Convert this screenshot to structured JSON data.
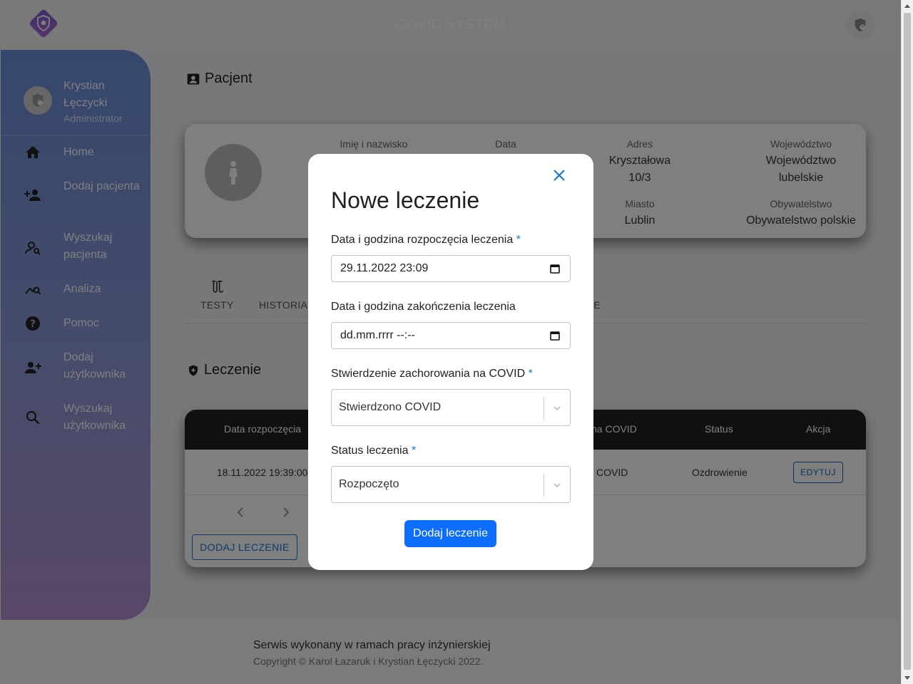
{
  "header": {
    "title": "COVID SYSTEM"
  },
  "user": {
    "name": "Krystian Łęczycki",
    "role": "Administrator"
  },
  "sidebar": {
    "items": [
      {
        "label": "Home",
        "icon": "home-icon"
      },
      {
        "label": "Dodaj pacjenta",
        "icon": "add-person-icon"
      },
      {
        "label": "Wyszukaj pacjenta",
        "icon": "person-search-icon"
      },
      {
        "label": "Analiza",
        "icon": "analytics-icon"
      },
      {
        "label": "Pomoc",
        "icon": "help-icon"
      },
      {
        "label": "Dodaj użytkownika",
        "icon": "add-group-icon"
      },
      {
        "label": "Wyszukaj użytkownika",
        "icon": "search-icon"
      }
    ]
  },
  "patient_section": {
    "title": "Pacjent"
  },
  "patient": {
    "fields": [
      {
        "label": "Imię i nazwisko",
        "value": ""
      },
      {
        "label": "Data",
        "value": ""
      },
      {
        "label": "Adres",
        "value": "Kryształowa 10/3"
      },
      {
        "label": "Województwo",
        "value": "Województwo lubelskie"
      },
      {
        "label": "Miasto",
        "value": "Lublin"
      },
      {
        "label": "Obywatelstwo",
        "value": "Obywatelstwo polskie"
      }
    ]
  },
  "tabs": [
    {
      "label": "TESTY"
    },
    {
      "label": "HISTORIA"
    },
    {
      "label": "IE"
    }
  ],
  "treatment_section": {
    "title": "Leczenie"
  },
  "table": {
    "headers": [
      "Data rozpoczęcia",
      "na COVID",
      "Status",
      "Akcja"
    ],
    "rows": [
      {
        "start": "18.11.2022 19:39:00",
        "covid": "COVID",
        "status": "Ozdrowienie",
        "action": "EDYTUJ"
      }
    ],
    "add_button": "DODAJ LECZENIE"
  },
  "footer": {
    "line1": "Serwis wykonany w ramach pracy inżynierskiej",
    "line2": "Copyright © Karol Łazaruk i Krystian Łęczycki 2022."
  },
  "modal": {
    "title": "Nowe leczenie",
    "start_label": "Data i godzina rozpoczęcia leczenia",
    "start_value": "29.11.2022 23:09",
    "end_label": "Data i godzina zakończenia leczenia",
    "end_placeholder": "dd.mm.rrrr --:--",
    "covid_label": "Stwierdzenie zachorowania na COVID",
    "covid_value": "Stwierdzono COVID",
    "status_label": "Status leczenia",
    "status_value": "Rozpoczęto",
    "submit": "Dodaj leczenie",
    "required_mark": "*"
  },
  "colors": {
    "accent": "#0d6efd",
    "table_header": "#212121",
    "required": "#1976d2"
  }
}
